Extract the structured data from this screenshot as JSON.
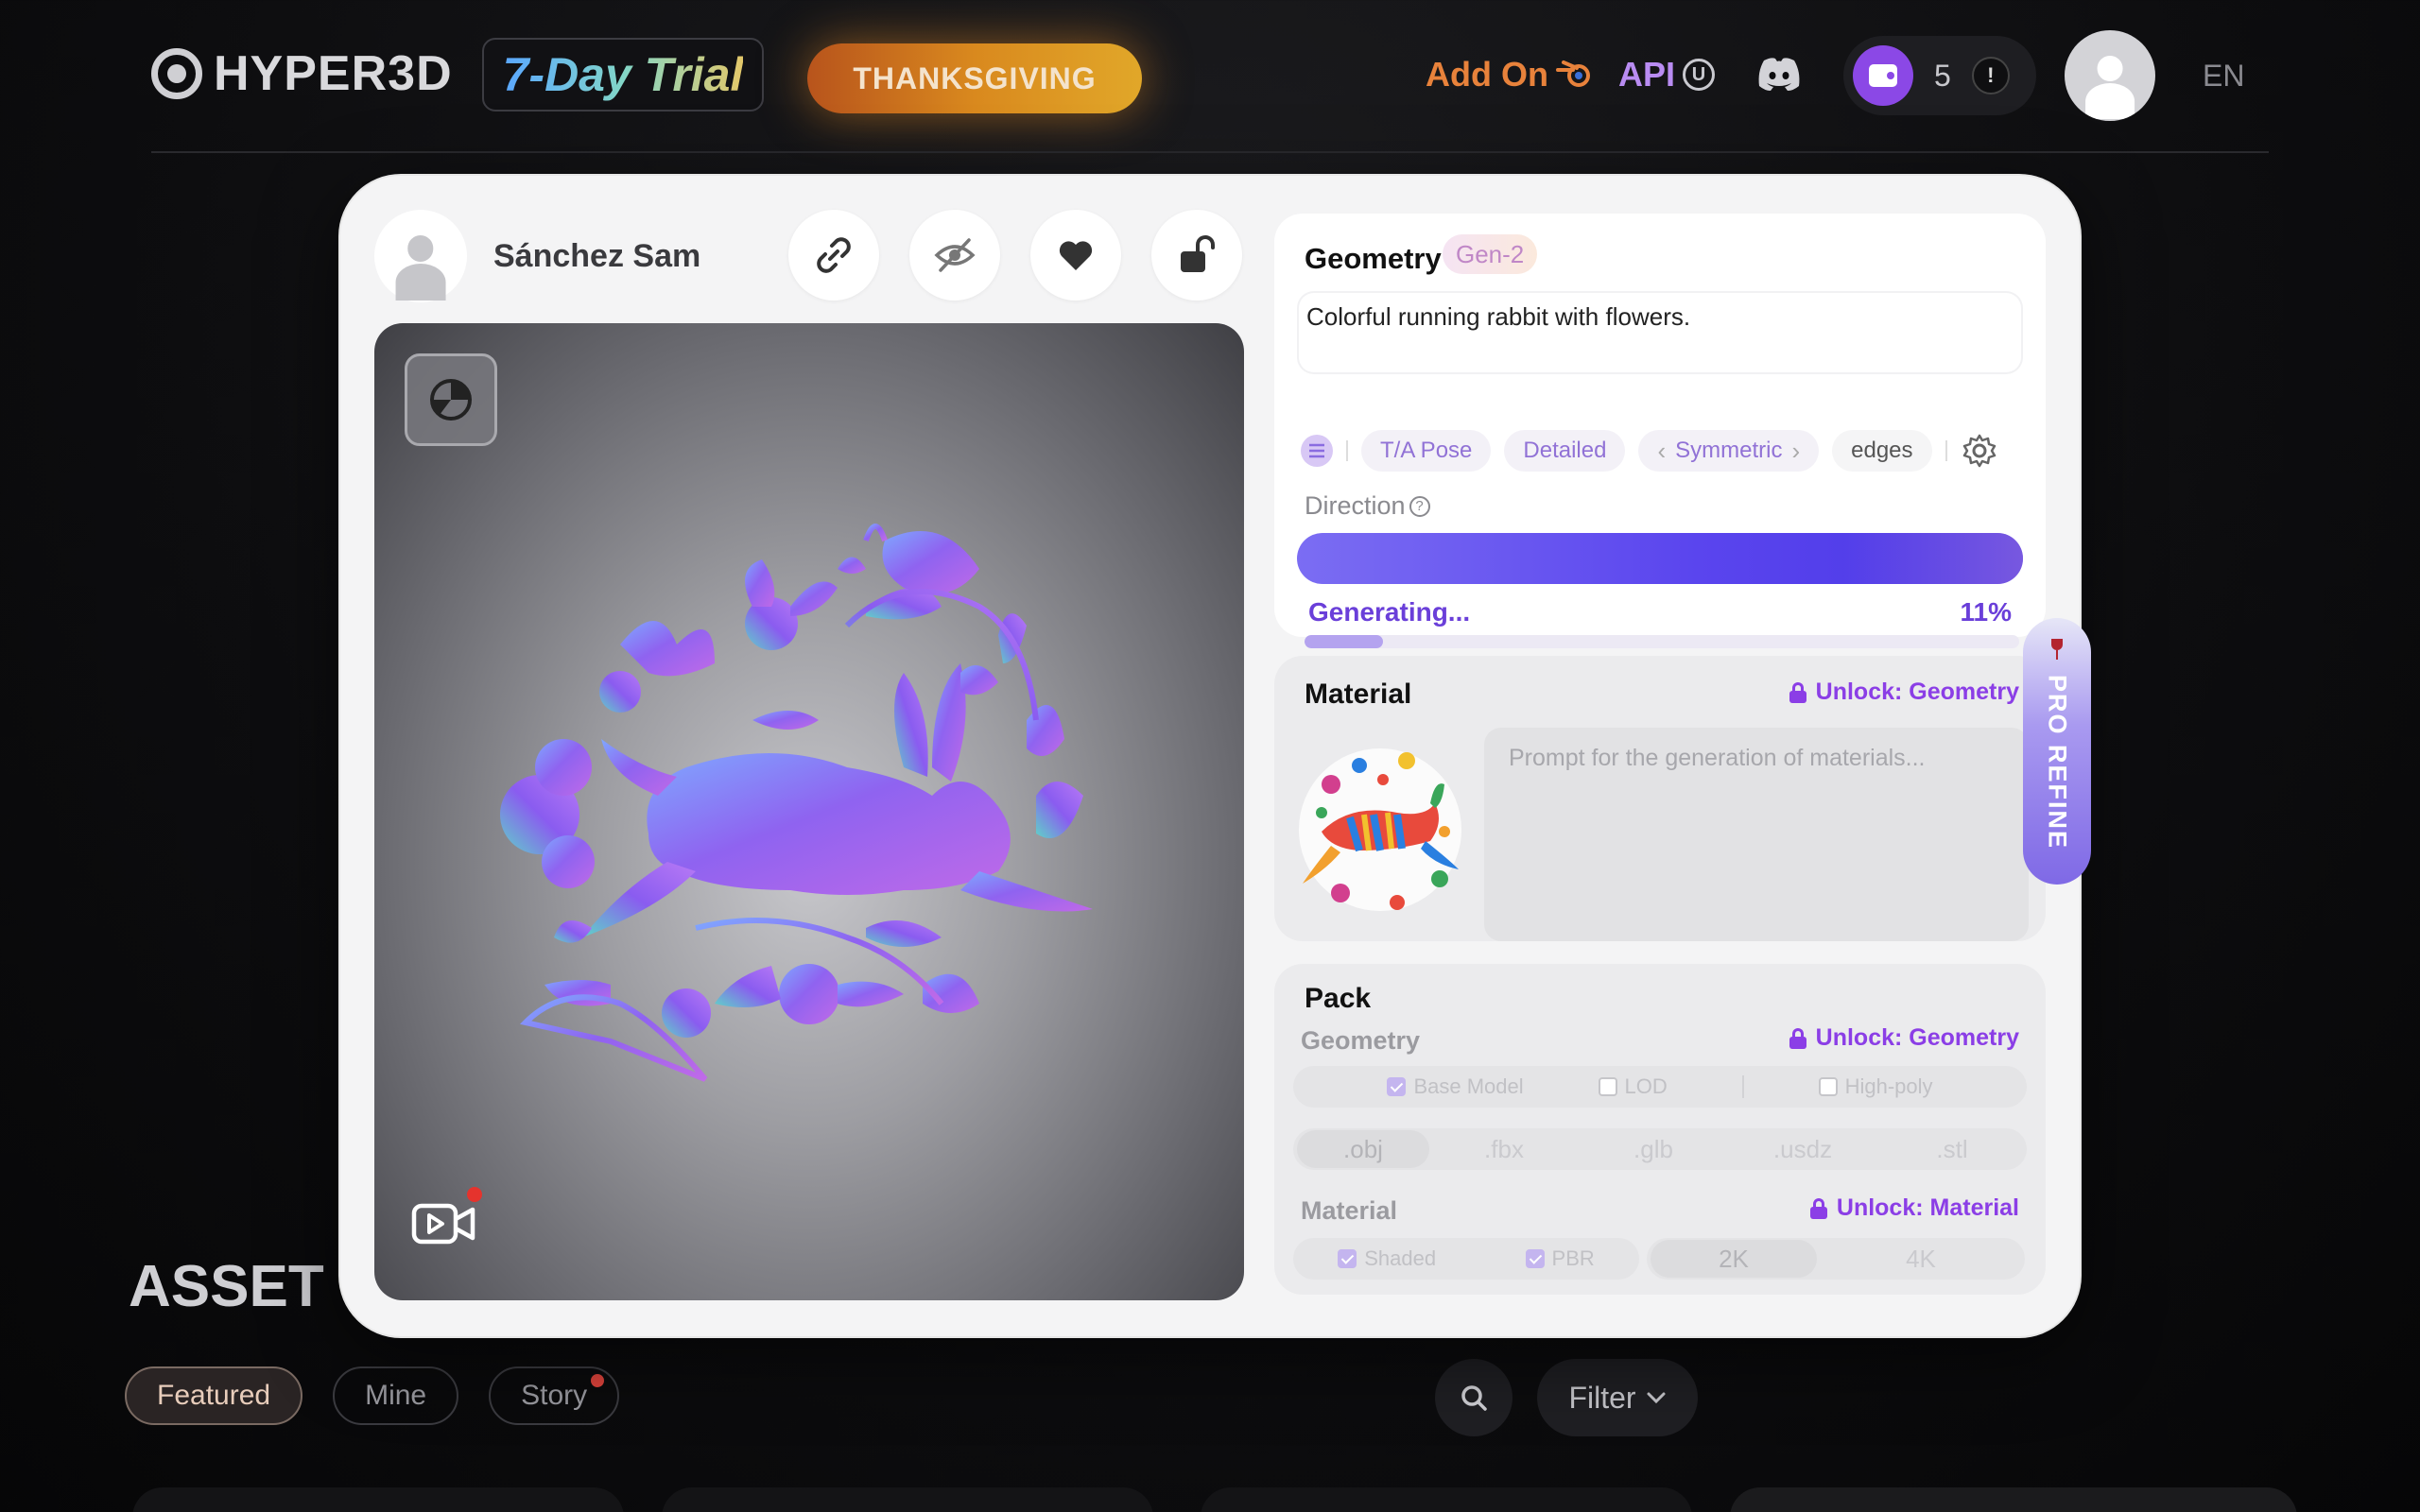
{
  "nav": {
    "logo_text": "HYPER3D",
    "trial_label": "7-Day Trial",
    "promo_label": "THANKSGIVING",
    "addon_label": "Add On",
    "api_label": "API",
    "api_badge": "U",
    "credits": "5",
    "alert_mark": "!",
    "language": "EN"
  },
  "page": {
    "section_title": "ASSET",
    "chips": [
      {
        "label": "Featured",
        "active": true
      },
      {
        "label": "Mine",
        "active": false
      },
      {
        "label": "Story",
        "active": false,
        "dot": true
      }
    ],
    "filter_label": "Filter"
  },
  "modal": {
    "user_name": "Sánchez Sam",
    "actions": [
      "link-icon",
      "hide-icon",
      "heart-icon",
      "unlock-icon"
    ],
    "geometry": {
      "title": "Geometry",
      "badge": "Gen-2",
      "prompt": "Colorful running rabbit with flowers.",
      "tags": [
        "T/A Pose",
        "Detailed",
        "Symmetric",
        "edges"
      ],
      "direction_label": "Direction",
      "status": "Generating...",
      "progress_label": "11%",
      "progress": 0.11
    },
    "material": {
      "title": "Material",
      "unlock_label": "Unlock: Geometry",
      "prompt_placeholder": "Prompt for the generation of materials..."
    },
    "pack": {
      "title": "Pack",
      "geometry_label": "Geometry",
      "geometry_unlock": "Unlock: Geometry",
      "geometry_options": [
        "Base Model",
        "LOD",
        "High-poly"
      ],
      "formats": [
        ".obj",
        ".fbx",
        ".glb",
        ".usdz",
        ".stl"
      ],
      "material_label": "Material",
      "material_unlock": "Unlock: Material",
      "material_options": [
        "Shaded",
        "PBR"
      ],
      "resolutions": [
        "2K",
        "4K"
      ]
    },
    "pro_refine_label": "PRO REFINE"
  },
  "colors": {
    "accent_purple": "#8b3ee6",
    "promo_orange": "#d9891e",
    "addon_orange": "#e8823b"
  }
}
